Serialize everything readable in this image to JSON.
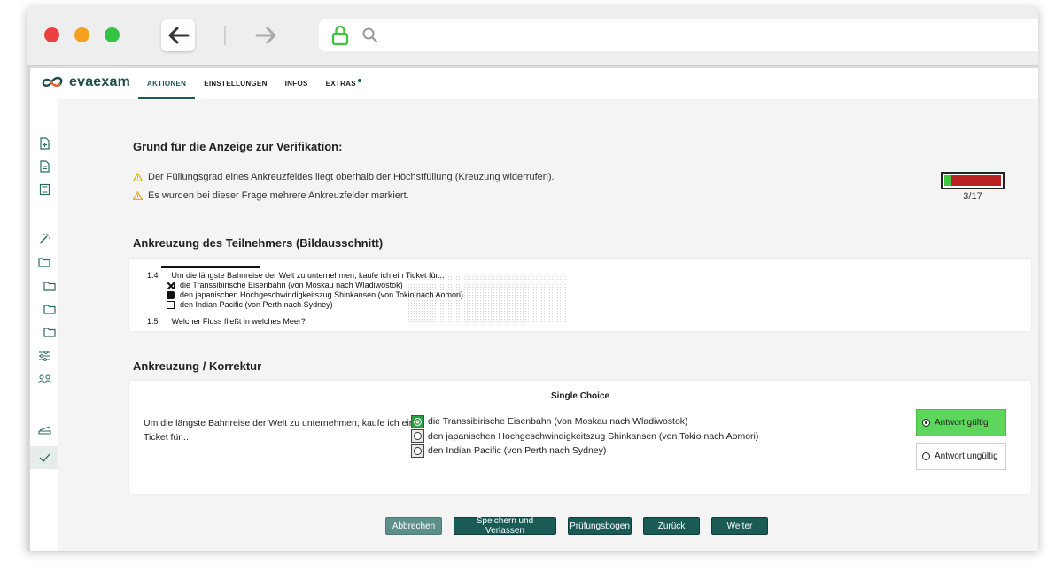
{
  "browser": {
    "back_icon": "arrow-left-icon",
    "forward_icon": "arrow-right-icon",
    "lock_icon": "lock-icon",
    "search_icon": "search-icon"
  },
  "app": {
    "logo_text": "evaexam",
    "accent_color": "#1a5c55",
    "tabs": [
      {
        "label": "AKTIONEN",
        "active": true
      },
      {
        "label": "EINSTELLUNGEN",
        "active": false
      },
      {
        "label": "INFOS",
        "active": false
      },
      {
        "label": "EXTRAS",
        "active": false
      }
    ]
  },
  "sidebar": {
    "icons": [
      "file-add-icon",
      "file-icon",
      "book-icon",
      "magic-wand-icon",
      "folder-icon",
      "folder-icon",
      "folder-icon",
      "folder-icon",
      "sliders-icon",
      "users-icon",
      "tray-icon",
      "check-icon"
    ]
  },
  "verification": {
    "title": "Grund für die Anzeige zur Verifikation:",
    "warnings": [
      "Der Füllungsgrad eines Ankreuzfeldes liegt oberhalb der Höchstfüllung (Kreuzung widerrufen).",
      "Es wurden bei dieser Frage mehrere Ankreuzfelder markiert."
    ],
    "progress_label": "3/17",
    "progress_fraction": 0.12,
    "progress_ok_color": "#3ec43e",
    "progress_rest_color": "#bb2222"
  },
  "scan": {
    "title": "Ankreuzung des Teilnehmers (Bildausschnitt)",
    "q_number": "1.4",
    "q_text": "Um die längste Bahnreise der Welt zu unternehmen, kaufe ich ein Ticket für...",
    "options": [
      "die Transsibirische Eisenbahn (von Moskau nach Wladiwostok)",
      "den japanischen Hochgeschwindigkeitszug Shinkansen (von Tokio nach Aomori)",
      "den Indian Pacific (von Perth nach Sydney)"
    ],
    "next_q_number": "1.5",
    "next_q_text": "Welcher Fluss fließt in welches Meer?"
  },
  "correction": {
    "title": "Ankreuzung / Korrektur",
    "type_label": "Single Choice",
    "question": "Um die längste Bahnreise der Welt zu unternehmen, kaufe ich ein Ticket für...",
    "options": [
      {
        "label": "die Transsibirische Eisenbahn (von Moskau nach Wladiwostok)",
        "selected": true
      },
      {
        "label": "den japanischen Hochgeschwindigkeitszug Shinkansen (von Tokio nach Aomori)",
        "selected": false
      },
      {
        "label": "den Indian Pacific (von Perth nach Sydney)",
        "selected": false
      }
    ],
    "valid_label": "Antwort gültig",
    "invalid_label": "Antwort ungültig",
    "valid_color": "#5cd65c"
  },
  "actions": {
    "cancel": "Abbrechen",
    "save_exit": "Speichern und Verlassen",
    "exam_sheet": "Prüfungsbogen",
    "back": "Zurück",
    "next": "Weiter"
  }
}
